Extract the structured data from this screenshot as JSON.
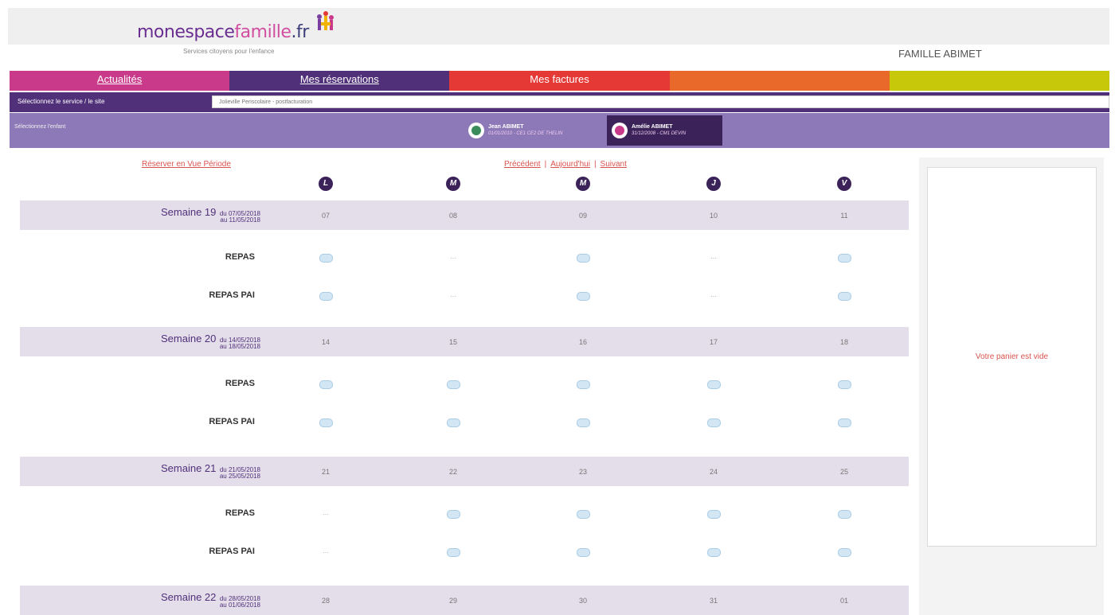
{
  "brand": {
    "part1": "mon",
    "part2": "espace",
    "part3": "famille",
    "part4": ".fr",
    "tagline": "Services citoyens pour l'enfance"
  },
  "family": "FAMILLE ABIMET",
  "nav": [
    {
      "label": "Actualités",
      "color": "#c93a8a",
      "underline": true
    },
    {
      "label": "Mes réservations",
      "color": "#51307a",
      "underline": true
    },
    {
      "label": "Mes factures",
      "color": "#e53935",
      "underline": false
    },
    {
      "label": "",
      "color": "#e8692a",
      "underline": false
    },
    {
      "label": "",
      "color": "#c8c80a",
      "underline": false
    }
  ],
  "service": {
    "label": "Sélectionnez le service / le site",
    "value": "Jolieville Periscolaire - postfacturation"
  },
  "child_select": {
    "label": "Sélectionnez l'enfant"
  },
  "children": [
    {
      "name": "Jean ABIMET",
      "info": "01/01/2010 - CE1 CE2 DE THELIN"
    },
    {
      "name": "Amélie ABIMET",
      "info": "31/12/2008 - CM1 DEVIN"
    }
  ],
  "links": {
    "reserve": "Réserver en Vue Période",
    "prev": "Précédent",
    "today": "Aujourd'hui",
    "next": "Suivant",
    "sep": "|"
  },
  "days": [
    "L",
    "M",
    "M",
    "J",
    "V"
  ],
  "weeks": [
    {
      "title": "Semaine 19",
      "from": "du 07/05/2018",
      "to": "au 11/05/2018",
      "dates": [
        "07",
        "08",
        "09",
        "10",
        "11"
      ],
      "rows": [
        {
          "label": "REPAS",
          "cells": [
            "slot",
            "dots",
            "slot",
            "dots",
            "slot"
          ]
        },
        {
          "label": "REPAS PAI",
          "cells": [
            "slot",
            "dots",
            "slot",
            "dots",
            "slot"
          ]
        }
      ]
    },
    {
      "title": "Semaine 20",
      "from": "du 14/05/2018",
      "to": "au 18/05/2018",
      "dates": [
        "14",
        "15",
        "16",
        "17",
        "18"
      ],
      "rows": [
        {
          "label": "REPAS",
          "cells": [
            "slot",
            "slot",
            "slot",
            "slot",
            "slot"
          ]
        },
        {
          "label": "REPAS PAI",
          "cells": [
            "slot",
            "slot",
            "slot",
            "slot",
            "slot"
          ]
        }
      ]
    },
    {
      "title": "Semaine 21",
      "from": "du 21/05/2018",
      "to": "au 25/05/2018",
      "dates": [
        "21",
        "22",
        "23",
        "24",
        "25"
      ],
      "rows": [
        {
          "label": "REPAS",
          "cells": [
            "dots",
            "slot",
            "slot",
            "slot",
            "slot"
          ]
        },
        {
          "label": "REPAS PAI",
          "cells": [
            "dots",
            "slot",
            "slot",
            "slot",
            "slot"
          ]
        }
      ]
    },
    {
      "title": "Semaine 22",
      "from": "du 28/05/2018",
      "to": "au 01/06/2018",
      "dates": [
        "28",
        "29",
        "30",
        "31",
        "01"
      ],
      "rows": []
    }
  ],
  "dots_text": "···",
  "cart": {
    "empty": "Votre panier est vide"
  }
}
